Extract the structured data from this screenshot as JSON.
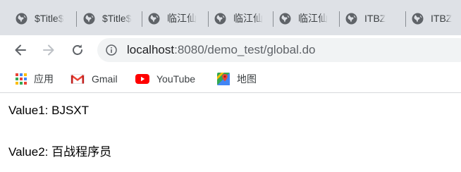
{
  "tabs": [
    {
      "title": "$Title$"
    },
    {
      "title": "$Title$"
    },
    {
      "title": "临江仙"
    },
    {
      "title": "临江仙"
    },
    {
      "title": "临江仙"
    },
    {
      "title": "ITBZ"
    },
    {
      "title": "ITBZ"
    }
  ],
  "toolbar": {
    "back_icon": "arrow-left-icon",
    "forward_icon": "arrow-right-icon",
    "reload_icon": "reload-icon",
    "address": {
      "host": "localhost",
      "path": ":8080/demo_test/global.do"
    }
  },
  "bookmarks": [
    {
      "label": "应用",
      "icon": "apps-grid-icon"
    },
    {
      "label": "Gmail",
      "icon": "gmail-icon"
    },
    {
      "label": "YouTube",
      "icon": "youtube-icon"
    },
    {
      "label": "地图",
      "icon": "maps-icon"
    }
  ],
  "content": {
    "line1": "Value1: BJSXT",
    "line2": "Value2: 百战程序员"
  },
  "colors": {
    "tab_strip": "#dee1e6",
    "omnibox": "#f1f3f4",
    "icon_gray": "#5f6368",
    "youtube_red": "#ff0000",
    "gmail_red": "#ea4335"
  }
}
